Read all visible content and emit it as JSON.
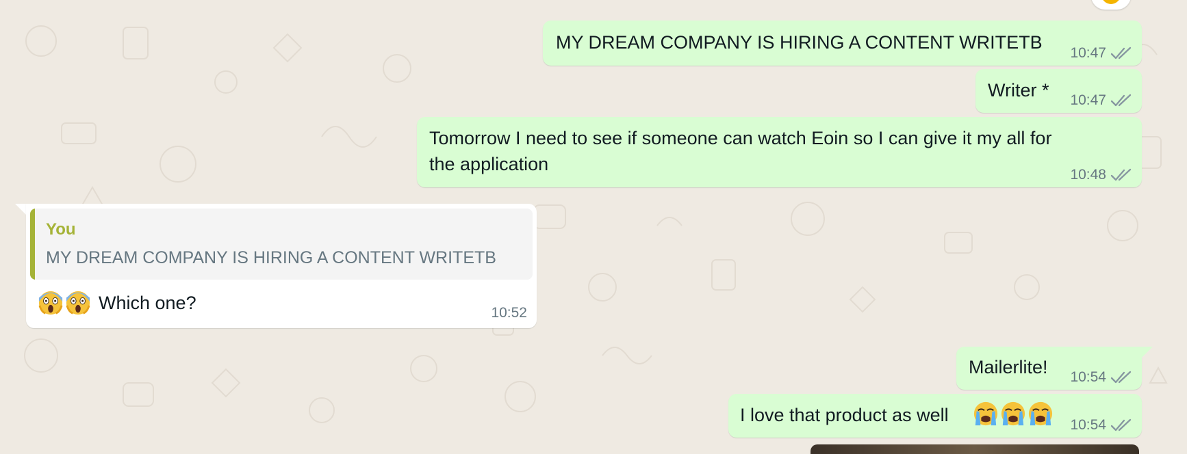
{
  "chat": {
    "messages": [
      {
        "direction": "outgoing",
        "text": "MY DREAM COMPANY IS HIRING A CONTENT WRITETB",
        "time": "10:47",
        "status": "read"
      },
      {
        "direction": "outgoing",
        "text": "Writer *",
        "time": "10:47",
        "status": "read"
      },
      {
        "direction": "outgoing",
        "lines": [
          "Tomorrow I need to see if someone can watch Eoin so I can give it my all for",
          "the application"
        ],
        "time": "10:48",
        "status": "read"
      },
      {
        "direction": "incoming",
        "quoted": {
          "author": "You",
          "text": "MY DREAM COMPANY IS HIRING A CONTENT WRITETB"
        },
        "emojis": [
          "screaming-face-emoji",
          "screaming-face-emoji"
        ],
        "text": "Which one?",
        "time": "10:52"
      },
      {
        "direction": "outgoing",
        "text": "Mailerlite!",
        "time": "10:54",
        "status": "read"
      },
      {
        "direction": "outgoing",
        "text": "I love that product as well",
        "emojis": [
          "loudly-crying-face-emoji",
          "loudly-crying-face-emoji",
          "loudly-crying-face-emoji"
        ],
        "time": "10:54",
        "status": "read"
      }
    ]
  },
  "colors": {
    "background": "#efeae2",
    "outgoing_bubble": "#d9fdd3",
    "incoming_bubble": "#ffffff",
    "quote_accent": "#a5b337",
    "meta_text": "#667781",
    "tick_color": "#8696a0"
  }
}
